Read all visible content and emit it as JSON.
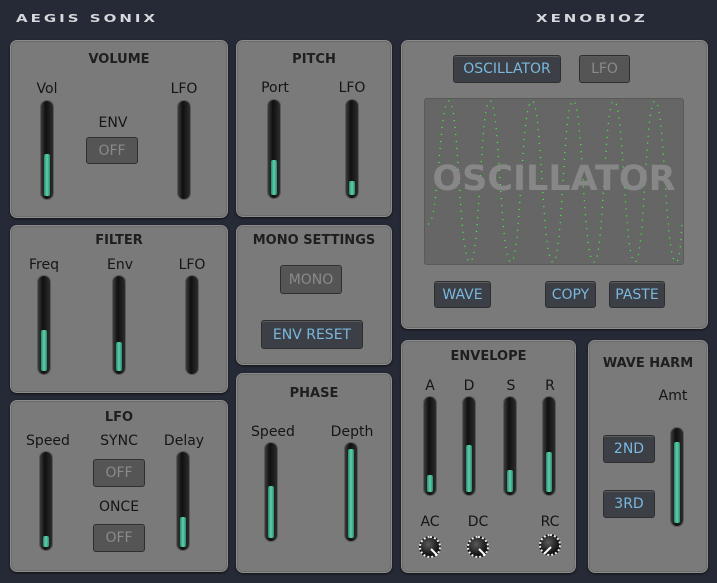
{
  "header": {
    "left_brand": "AEGIS SONIX",
    "right_brand": "XENOBIOZ"
  },
  "colors": {
    "fill": "#5fd0ac",
    "button_text_active": "#7ab8e0",
    "wave": "#3dff3d"
  },
  "volume": {
    "title": "VOLUME",
    "vol_label": "Vol",
    "env_label": "ENV",
    "env_button": "OFF",
    "lfo_label": "LFO",
    "vol_level": 0.46,
    "lfo_level": 0.0
  },
  "pitch": {
    "title": "PITCH",
    "port_label": "Port",
    "lfo_label": "LFO",
    "port_level": 0.38,
    "lfo_level": 0.15
  },
  "filter": {
    "title": "FILTER",
    "freq_label": "Freq",
    "env_label": "Env",
    "lfo_label": "LFO",
    "freq_level": 0.45,
    "env_level": 0.32,
    "lfo_level": 0.0
  },
  "mono": {
    "title": "MONO SETTINGS",
    "mono_button": "MONO",
    "env_reset_button": "ENV RESET"
  },
  "lfo": {
    "title": "LFO",
    "speed_label": "Speed",
    "sync_label": "SYNC",
    "sync_button": "OFF",
    "once_label": "ONCE",
    "once_button": "OFF",
    "delay_label": "Delay",
    "speed_level": 0.12,
    "delay_level": 0.33
  },
  "phase": {
    "title": "PHASE",
    "speed_label": "Speed",
    "depth_label": "Depth",
    "speed_level": 0.56,
    "depth_level": 0.97
  },
  "oscillator": {
    "tab_oscillator": "OSCILLATOR",
    "tab_lfo": "LFO",
    "display_text": "OSCILLATOR",
    "wave_button": "WAVE",
    "copy_button": "COPY",
    "paste_button": "PASTE"
  },
  "envelope": {
    "title": "ENVELOPE",
    "a_label": "A",
    "d_label": "D",
    "s_label": "S",
    "r_label": "R",
    "ac_label": "AC",
    "dc_label": "DC",
    "rc_label": "RC",
    "a_level": 0.18,
    "d_level": 0.51,
    "s_level": 0.24,
    "r_level": 0.44
  },
  "wave_harm": {
    "title": "WAVE HARM",
    "amt_label": "Amt",
    "second_button": "2ND",
    "third_button": "3RD",
    "amt_level": 0.88
  }
}
